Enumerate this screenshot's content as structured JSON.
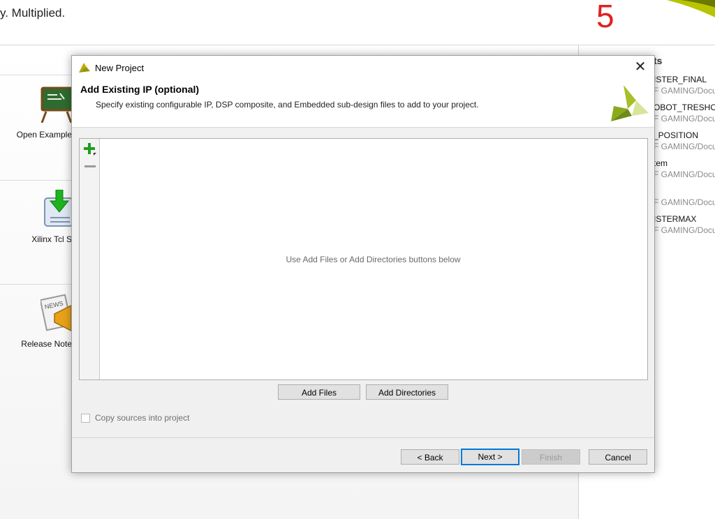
{
  "background": {
    "tagline": "y. Multiplied.",
    "badge_number": "5",
    "tiles": [
      {
        "label": "Open Example"
      },
      {
        "label": "Xilinx Tcl S"
      },
      {
        "label": "Release Note"
      }
    ],
    "recent": {
      "heading": "ts",
      "items": [
        {
          "name": "ISTER_FINAL",
          "path": "F GAMING/Docur"
        },
        {
          "name": "OBOT_TRESHOL",
          "path": "F GAMING/Docur"
        },
        {
          "name": "_POSITION",
          "path": "F GAMING/Docur"
        },
        {
          "name": "tem",
          "path": "F GAMING/Docur"
        },
        {
          "name": "",
          "path": "F GAMING/Docur"
        },
        {
          "name": "ISTERMAX",
          "path": "F GAMING/Docur"
        }
      ]
    }
  },
  "dialog": {
    "window_title": "New Project",
    "page_title": "Add Existing IP (optional)",
    "page_description": "Specify existing configurable IP, DSP composite, and Embedded sub-design files to add to your project.",
    "empty_hint": "Use Add Files or Add Directories buttons below",
    "add_files_label": "Add Files",
    "add_directories_label": "Add Directories",
    "copy_sources_label": "Copy sources into project",
    "copy_sources_checked": false,
    "buttons": {
      "back": "< Back",
      "next": "Next >",
      "finish": "Finish",
      "cancel": "Cancel"
    }
  },
  "colors": {
    "accent_border": "#0078d7",
    "badge_red": "#e02020",
    "logo_green": "#8aaa1c"
  }
}
